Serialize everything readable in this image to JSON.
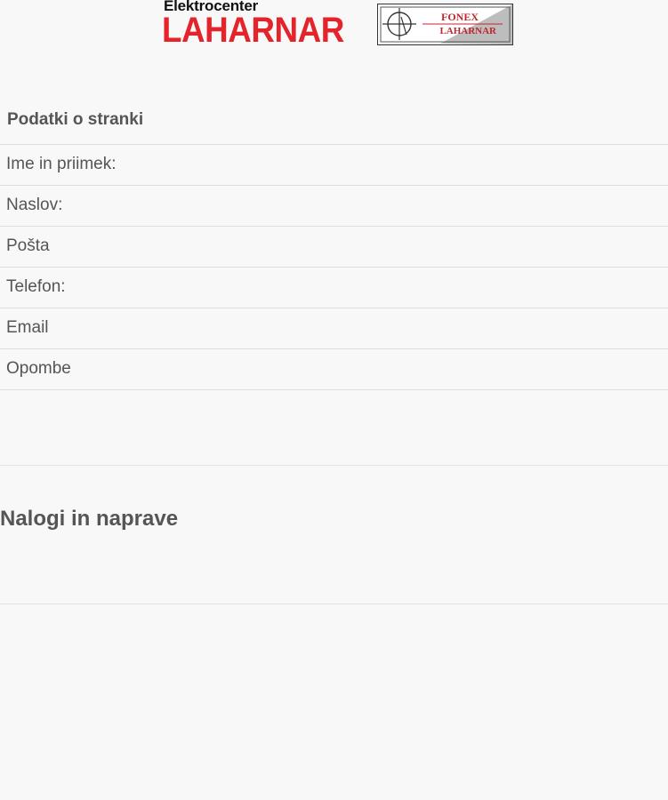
{
  "header": {
    "logo_sub": "Elektrocenter",
    "logo_main": "LAHARNAR",
    "badge_line1": "FONEX",
    "badge_line2": "LAHARNAR"
  },
  "customer": {
    "title": "Podatki o stranki",
    "fields": [
      {
        "label": "Ime in priimek:"
      },
      {
        "label": "Naslov:"
      },
      {
        "label": "Pošta"
      },
      {
        "label": "Telefon:"
      },
      {
        "label": "Email"
      },
      {
        "label": "Opombe"
      }
    ]
  },
  "orders": {
    "title": "Nalogi in naprave"
  },
  "colors": {
    "brand_red": "#e3242b",
    "text": "#555555",
    "background": "#f8f8f8"
  }
}
